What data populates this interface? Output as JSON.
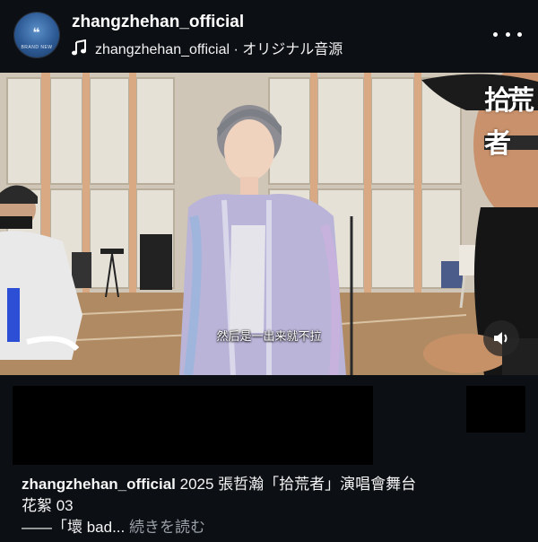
{
  "header": {
    "username": "zhangzhehan_official",
    "audio_label": "zhangzhehan_official · オリジナル音源",
    "avatar_text": "❝",
    "avatar_subtext": "BRAND NEW"
  },
  "video": {
    "subtitle": "然后是一出来就不拉",
    "watermark": "拾荒者"
  },
  "caption": {
    "username": "zhangzhehan_official",
    "text_line1": " 2025 張哲瀚「拾荒者」演唱會舞台",
    "text_line2": "花絮 03",
    "text_line3": "——「壞 bad...",
    "more_label": "続きを読む"
  },
  "colors": {
    "background": "#0c0f14",
    "text": "#ffffff",
    "muted": "#9aa0a8"
  },
  "icons": [
    "music-note-icon",
    "more-options-icon",
    "speaker-icon"
  ]
}
